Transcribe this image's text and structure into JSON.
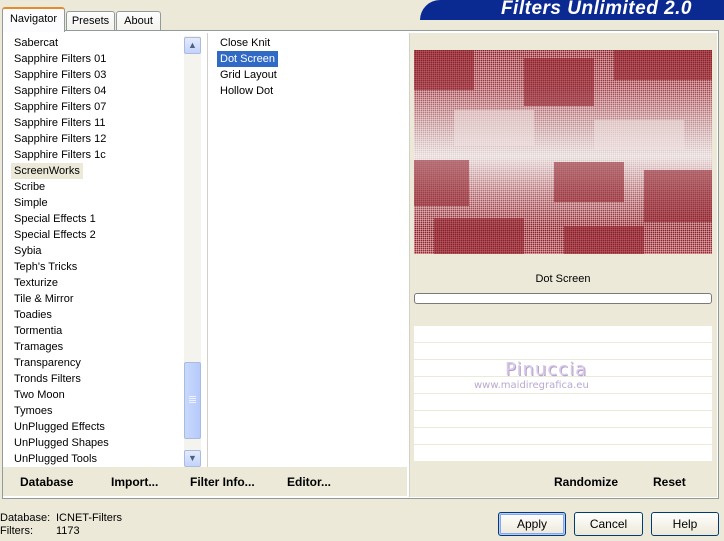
{
  "tabs": [
    "Navigator",
    "Presets",
    "About"
  ],
  "banner_title": "Filters Unlimited 2.0",
  "categories": [
    "Sabercat",
    "Sapphire Filters 01",
    "Sapphire Filters 03",
    "Sapphire Filters 04",
    "Sapphire Filters 07",
    "Sapphire Filters 11",
    "Sapphire Filters 12",
    "Sapphire Filters 1c",
    "ScreenWorks",
    "Scribe",
    "Simple",
    "Special Effects 1",
    "Special Effects 2",
    "Sybia",
    "Teph's Tricks",
    "Texturize",
    "Tile & Mirror",
    "Toadies",
    "Tormentia",
    "Tramages",
    "Transparency",
    "Tronds Filters",
    "Two Moon",
    "Tymoes",
    "UnPlugged Effects",
    "UnPlugged Shapes",
    "UnPlugged Tools"
  ],
  "selected_category": "ScreenWorks",
  "filters": [
    "Close Knit",
    "Dot Screen",
    "Grid Layout",
    "Hollow Dot"
  ],
  "selected_filter": "Dot Screen",
  "filter_name": "Dot Screen",
  "watermark": {
    "line1": "Pinuccia",
    "line2": "www.maidiregrafica.eu"
  },
  "toolbar": {
    "database": "Database",
    "import": "Import...",
    "filter_info": "Filter Info...",
    "editor": "Editor...",
    "randomize": "Randomize",
    "reset": "Reset"
  },
  "status": {
    "database_label": "Database:",
    "database_value": "ICNET-Filters",
    "filters_label": "Filters:",
    "filters_value": "1173"
  },
  "buttons": {
    "apply": "Apply",
    "cancel": "Cancel",
    "help": "Help"
  },
  "colors": {
    "accent": "#316ac5",
    "banner": "#0a2a92",
    "preview": "#8e1c26"
  }
}
